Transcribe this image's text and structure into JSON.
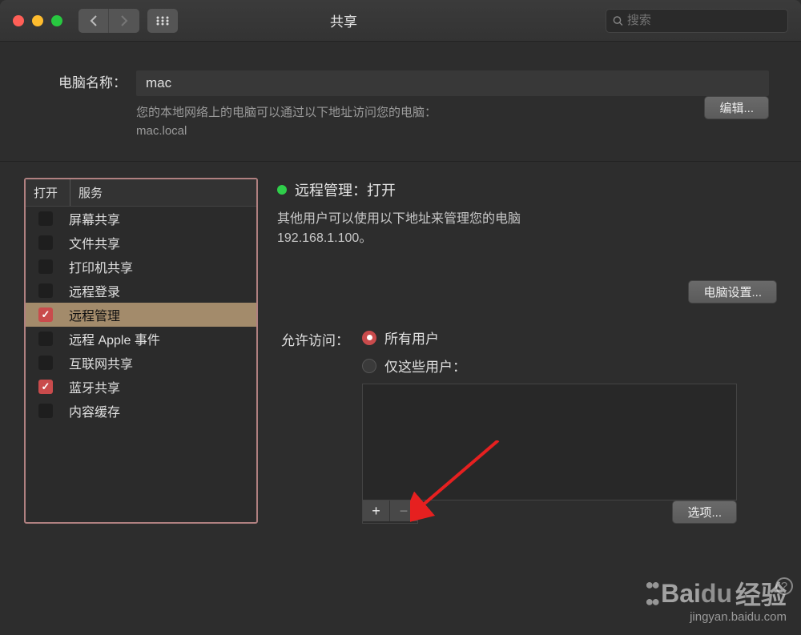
{
  "titlebar": {
    "title": "共享",
    "search_placeholder": "搜索"
  },
  "computer_name": {
    "label": "电脑名称：",
    "value": "mac",
    "hint_line1": "您的本地网络上的电脑可以通过以下地址访问您的电脑：",
    "hint_line2": "mac.local",
    "edit_button": "编辑..."
  },
  "services": {
    "header_on": "打开",
    "header_service": "服务",
    "items": [
      {
        "label": "屏幕共享",
        "checked": false,
        "selected": false
      },
      {
        "label": "文件共享",
        "checked": false,
        "selected": false
      },
      {
        "label": "打印机共享",
        "checked": false,
        "selected": false
      },
      {
        "label": "远程登录",
        "checked": false,
        "selected": false
      },
      {
        "label": "远程管理",
        "checked": true,
        "selected": true
      },
      {
        "label": "远程 Apple 事件",
        "checked": false,
        "selected": false
      },
      {
        "label": "互联网共享",
        "checked": false,
        "selected": false
      },
      {
        "label": "蓝牙共享",
        "checked": true,
        "selected": false
      },
      {
        "label": "内容缓存",
        "checked": false,
        "selected": false
      }
    ]
  },
  "detail": {
    "status_label": "远程管理：打开",
    "description_line1": "其他用户可以使用以下地址来管理您的电脑",
    "description_line2": "192.168.1.100。",
    "computer_settings_button": "电脑设置...",
    "access_label": "允许访问：",
    "radio_all": "所有用户",
    "radio_only": "仅这些用户：",
    "selected_radio": "all",
    "add_button": "+",
    "remove_button": "−",
    "options_button": "选项..."
  },
  "watermark": {
    "brand": "Bai",
    "brand2": "du",
    "suffix": "经验",
    "url": "jingyan.baidu.com"
  }
}
